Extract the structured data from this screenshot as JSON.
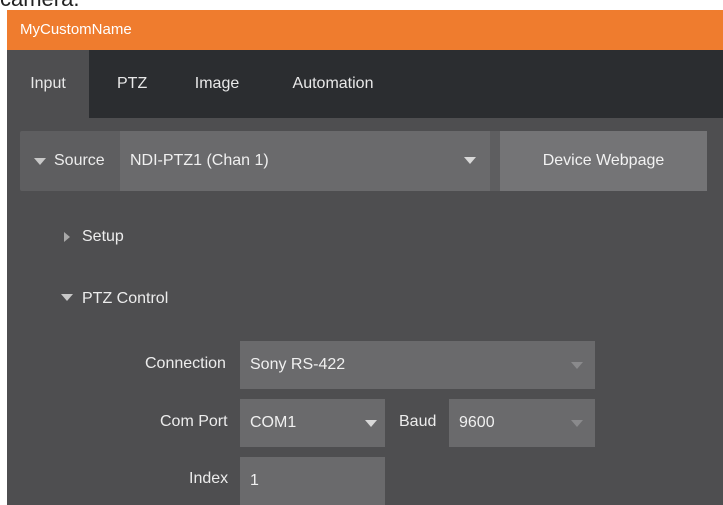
{
  "caption_fragment": "camera.",
  "window": {
    "title": "MyCustomName"
  },
  "tabs": [
    {
      "label": "Input",
      "active": true
    },
    {
      "label": "PTZ"
    },
    {
      "label": "Image"
    },
    {
      "label": "Automation"
    }
  ],
  "source": {
    "label": "Source",
    "selected": "NDI-PTZ1 (Chan 1)",
    "device_button": "Device Webpage"
  },
  "sections": {
    "setup": "Setup",
    "ptz_control": "PTZ Control"
  },
  "ptz": {
    "connection_label": "Connection",
    "connection_value": "Sony RS-422",
    "com_port_label": "Com Port",
    "com_port_value": "COM1",
    "baud_label": "Baud",
    "baud_value": "9600",
    "index_label": "Index",
    "index_value": "1"
  },
  "colors": {
    "titlebar": "#ef7c2e",
    "tabbar": "#2b2d30",
    "panel": "#4e4e50",
    "control": "#6a6a6c"
  },
  "icons": {
    "collapse": "triangle-down-icon",
    "expand": "triangle-right-icon",
    "dropdown": "dropdown-arrow-icon"
  }
}
